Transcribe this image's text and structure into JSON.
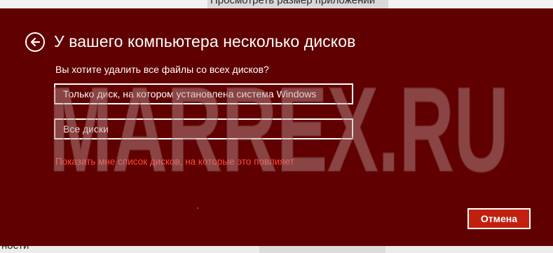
{
  "background": {
    "top_text": "Просмотреть размер приложений",
    "bottom_text": "ности"
  },
  "dialog": {
    "title": "У вашего компьютера несколько дисков",
    "subtitle": "Вы хотите удалить все файлы со всех дисков?",
    "options": [
      {
        "label": "Только диск, на котором установлена система Windows"
      },
      {
        "label": "Все диски"
      }
    ],
    "show_drives_link": "Показать мне список дисков, на которые это повлияет",
    "cancel_label": "Отмена",
    "back_icon": "back-arrow-icon"
  },
  "watermark": {
    "text": "MARREX.RU"
  },
  "colors": {
    "dialog_bg": "#600000",
    "link": "#ff4a3a",
    "cancel_bg": "#c2200f",
    "text": "#ffffff"
  }
}
